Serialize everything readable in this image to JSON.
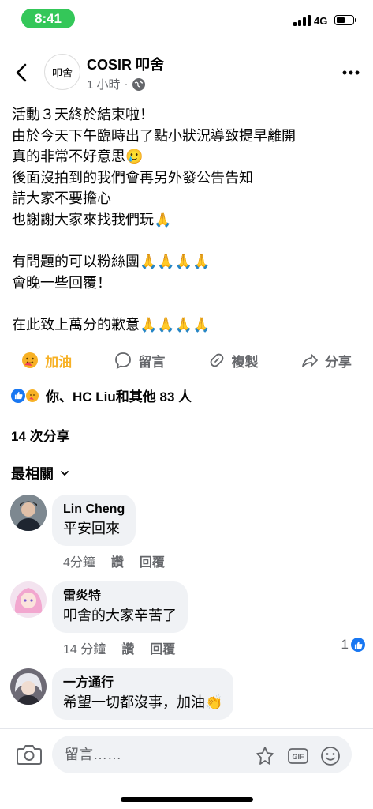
{
  "status_bar": {
    "time": "8:41",
    "network": "4G"
  },
  "header": {
    "page_name": "COSIR 叩舍",
    "time_ago": "1 小時",
    "separator": "·",
    "avatar_text": "叩舍"
  },
  "post": {
    "lines": [
      "活動３天終於結束啦！",
      "由於今天下午臨時出了點小狀況導致提早離開",
      "真的非常不好意思🥲",
      "後面沒拍到的我們會再另外發公告告知",
      "請大家不要擔心",
      "也謝謝大家來找我們玩🙏",
      "",
      "有問題的可以粉絲團🙏🙏🙏🙏",
      "會晚一些回覆！",
      "",
      "在此致上萬分的歉意🙏🙏🙏🙏"
    ]
  },
  "actions": {
    "care_label": "加油",
    "comment_label": "留言",
    "copy_label": "複製",
    "share_label": "分享"
  },
  "reactions_summary": "你、HC Liu和其他 83 人",
  "shares_count": "14 次分享",
  "sort_label": "最相關",
  "comments": [
    {
      "name": "Lin Cheng",
      "text": "平安回來",
      "time": "4分鐘",
      "like": "讚",
      "reply": "回覆",
      "like_count": ""
    },
    {
      "name": "雷炎特",
      "text": "叩舍的大家辛苦了",
      "time": "14 分鐘",
      "like": "讚",
      "reply": "回覆",
      "like_count": "1"
    },
    {
      "name": "一方通行",
      "text": "希望一切都沒事，加油👏",
      "time": "",
      "like": "",
      "reply": "",
      "like_count": ""
    }
  ],
  "composer": {
    "placeholder": "留言……"
  },
  "colors": {
    "brand_blue": "#1877f2",
    "care_yellow": "#f7b125",
    "status_green": "#34c759",
    "bubble_gray": "#f0f2f5",
    "meta_gray": "#65676b"
  }
}
